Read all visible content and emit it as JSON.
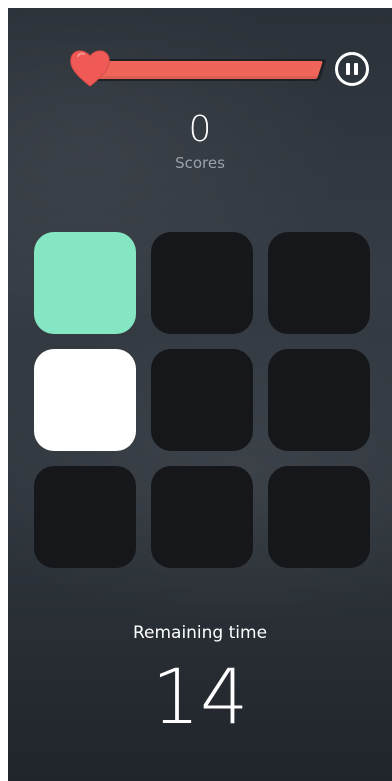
{
  "health": {
    "icon": "heart-icon",
    "level": 1.0,
    "fill_color": "#f0655a",
    "heart_color": "#ef5a56"
  },
  "pause": {
    "icon": "pause-icon"
  },
  "score": {
    "value": "0",
    "label": "Scores"
  },
  "grid": {
    "rows": 3,
    "cols": 3,
    "tiles": [
      {
        "state": "highlighted",
        "color": "#84e6c3"
      },
      {
        "state": "dark",
        "color": "#16171a"
      },
      {
        "state": "dark",
        "color": "#16171a"
      },
      {
        "state": "white",
        "color": "#ffffff"
      },
      {
        "state": "dark",
        "color": "#16171a"
      },
      {
        "state": "dark",
        "color": "#16171a"
      },
      {
        "state": "dark",
        "color": "#16171a"
      },
      {
        "state": "dark",
        "color": "#16171a"
      },
      {
        "state": "dark",
        "color": "#16171a"
      }
    ]
  },
  "timer": {
    "label": "Remaining time",
    "value": "14"
  }
}
